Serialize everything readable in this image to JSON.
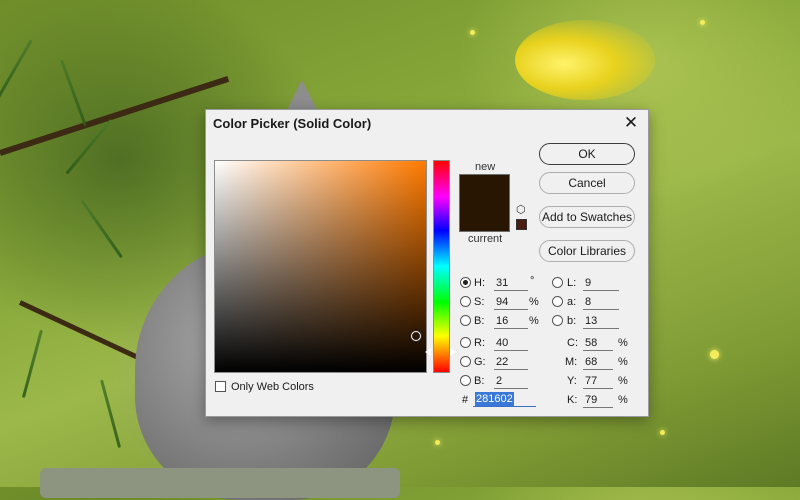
{
  "dialog": {
    "title": "Color Picker (Solid Color)",
    "close_glyph": "✕",
    "new_label": "new",
    "current_label": "current",
    "new_color": "#281602",
    "cube_icon": "3d-cube-icon",
    "ok_label": "OK",
    "cancel_label": "Cancel",
    "add_swatches_label": "Add to Swatches",
    "color_libraries_label": "Color Libraries",
    "only_web_colors_label": "Only Web Colors",
    "hsb": {
      "h_label": "H:",
      "h_value": "31",
      "h_unit": "°",
      "s_label": "S:",
      "s_value": "94",
      "s_unit": "%",
      "b_label": "B:",
      "b_value": "16",
      "b_unit": "%"
    },
    "rgb": {
      "r_label": "R:",
      "r_value": "40",
      "g_label": "G:",
      "g_value": "22",
      "b_label": "B:",
      "b_value": "2"
    },
    "lab": {
      "l_label": "L:",
      "l_value": "9",
      "a_label": "a:",
      "a_value": "8",
      "b_label": "b:",
      "b_value": "13"
    },
    "cmyk": {
      "c_label": "C:",
      "c_value": "58",
      "c_unit": "%",
      "m_label": "M:",
      "m_value": "68",
      "m_unit": "%",
      "y_label": "Y:",
      "y_value": "77",
      "y_unit": "%",
      "k_label": "K:",
      "k_value": "79",
      "k_unit": "%"
    },
    "hex_label": "#",
    "hex_value": "281602",
    "selected_mode": "H"
  }
}
